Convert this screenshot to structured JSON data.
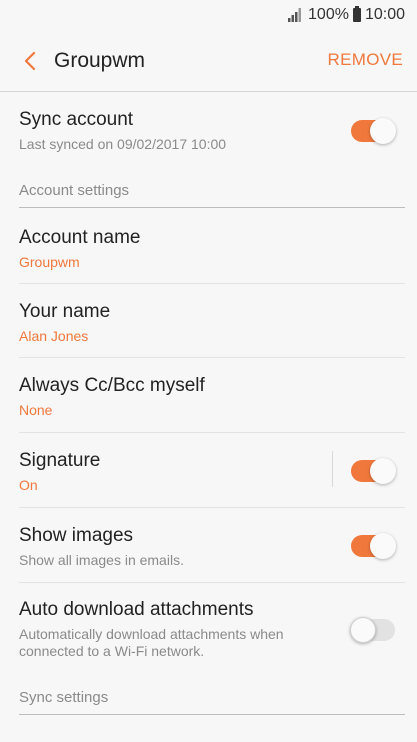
{
  "status_bar": {
    "battery_percent": "100%",
    "time": "10:00"
  },
  "app_bar": {
    "title": "Groupwm",
    "remove_label": "REMOVE"
  },
  "sync_account": {
    "title": "Sync account",
    "subtitle": "Last synced on 09/02/2017  10:00",
    "toggle_on": true
  },
  "account_settings_header": "Account settings",
  "items": {
    "account_name": {
      "title": "Account name",
      "value": "Groupwm"
    },
    "your_name": {
      "title": "Your name",
      "value": "Alan Jones"
    },
    "always_cc": {
      "title": "Always Cc/Bcc myself",
      "value": "None"
    },
    "signature": {
      "title": "Signature",
      "value": "On",
      "toggle_on": true
    },
    "show_images": {
      "title": "Show images",
      "subtitle": "Show all images in emails.",
      "toggle_on": true
    },
    "auto_download": {
      "title": "Auto download attachments",
      "subtitle": "Automatically download attachments when connected to a Wi-Fi network.",
      "toggle_on": false
    }
  },
  "sync_settings_header": "Sync settings",
  "colors": {
    "accent": "#f0783c",
    "background": "#f7f7f7"
  },
  "icons": [
    "signal-icon",
    "battery-icon",
    "back-icon"
  ]
}
